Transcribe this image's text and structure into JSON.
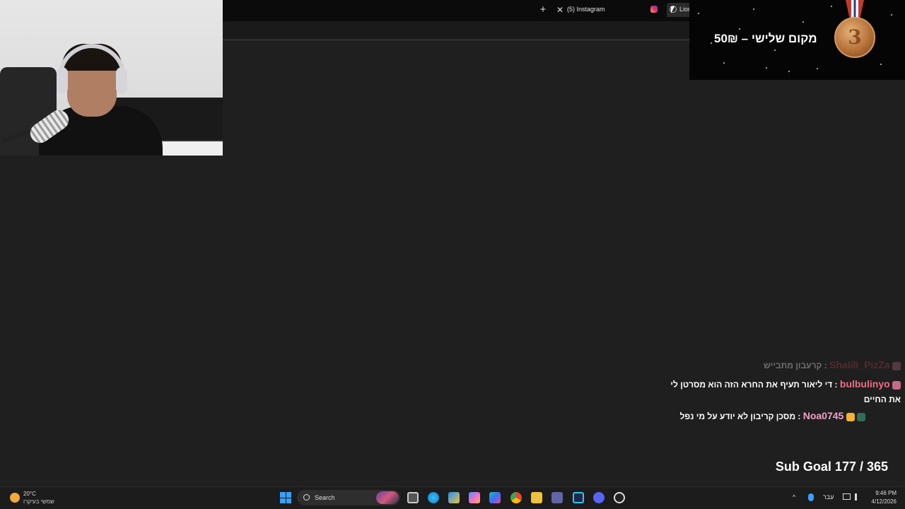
{
  "browser": {
    "tab_active_title": "(5) Instagram",
    "tab_second_title": "Lion",
    "new_tab_glyph": "+",
    "close_glyph": "✕"
  },
  "overlay": {
    "medal_text": "מקום שלישי – 50₪",
    "medal_number": "3",
    "colors": {
      "medal": "#b06c33",
      "overlay_bg": "#050505"
    }
  },
  "chat": {
    "messages": [
      {
        "user": "Shalili_PizZa",
        "text": "קרעבון מתבייש",
        "user_color": "#c0394f",
        "faded": true
      },
      {
        "user": "bulbulinyo",
        "text": "די ליאור תעיף את החרא הזה הוא מסרטן לי את החיים",
        "user_color": "#f06b8a",
        "faded": false
      },
      {
        "user": "Noa0745",
        "text": "מסכן קריבון לא יודע על מי נפל",
        "user_color": "#f2a0c4",
        "faded": false
      }
    ]
  },
  "sub_goal": "Sub Goal 177 / 365",
  "taskbar": {
    "weather_temp": "20°C",
    "weather_condition": "שמשי בעיקרו",
    "search_label": "Search",
    "language": "עבר",
    "time": "9:46 PM",
    "date": "4/12/2026",
    "icons": [
      "start-icon",
      "search-icon",
      "task-view-icon",
      "edge-icon",
      "store-icon",
      "copilot-icon",
      "ms365-icon",
      "chrome-icon",
      "file-explorer-icon",
      "teams-icon",
      "app-icon",
      "discord-icon",
      "obs-icon"
    ]
  }
}
